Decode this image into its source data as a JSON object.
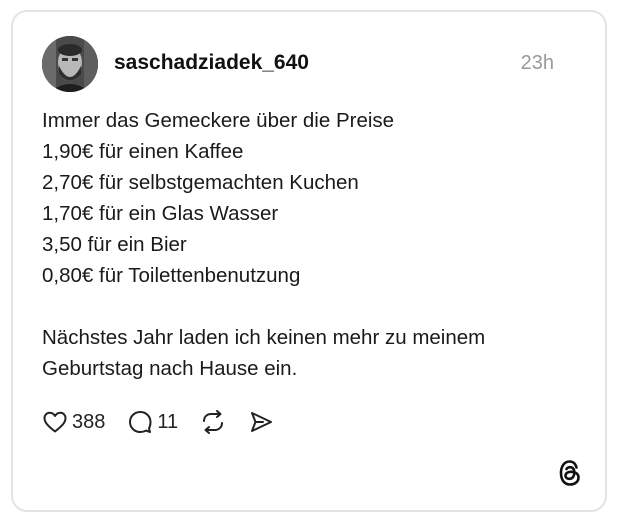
{
  "post": {
    "username": "saschadziadek_640",
    "timestamp": "23h",
    "lines": [
      "Immer das Gemeckere über die Preise",
      "1,90€ für einen Kaffee",
      "2,70€ für selbstgemachten Kuchen",
      "1,70€ für ein Glas Wasser",
      "3,50 für ein Bier",
      "0,80€ für Toilettenbenutzung"
    ],
    "closing_lines": [
      "Nächstes Jahr laden ich keinen mehr zu meinem",
      "Geburtstag nach Hause ein."
    ]
  },
  "actions": {
    "likes": "388",
    "replies": "11",
    "like_icon": "heart-icon",
    "reply_icon": "speech-bubble-icon",
    "repost_icon": "repost-icon",
    "share_icon": "send-icon"
  },
  "branding": {
    "logo": "threads-logo"
  },
  "colors": {
    "border": "#e3e3e3",
    "timestamp": "#9a9a9a",
    "text": "#1a1a1a"
  }
}
